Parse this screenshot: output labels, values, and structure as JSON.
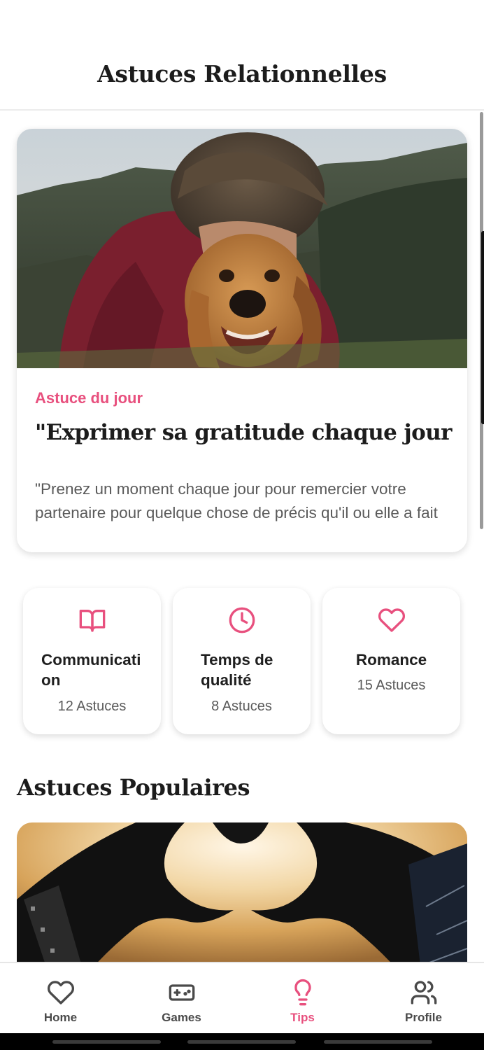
{
  "header": {
    "title": "Astuces Relationnelles"
  },
  "featured_tip": {
    "label": "Astuce du jour",
    "title": "\"Exprimer sa gratitude chaque jour",
    "body": "\"Prenez un moment chaque jour pour remercier votre partenaire pour quelque chose de précis qu'il ou elle a fait",
    "image": "man-hugging-golden-retriever-photo"
  },
  "categories": [
    {
      "icon": "book-icon",
      "name": "Communication",
      "count": "12 Astuces"
    },
    {
      "icon": "clock-icon",
      "name": "Temps de qualité",
      "count": "8 Astuces"
    },
    {
      "icon": "heart-icon",
      "name": "Romance",
      "count": "15 Astuces"
    }
  ],
  "popular": {
    "title": "Astuces Populaires",
    "image": "hands-forming-heart-sunset-photo"
  },
  "nav": {
    "items": [
      {
        "label": "Home",
        "icon": "heart-icon"
      },
      {
        "label": "Games",
        "icon": "gamepad-icon"
      },
      {
        "label": "Tips",
        "icon": "lightbulb-icon"
      },
      {
        "label": "Profile",
        "icon": "users-icon"
      }
    ],
    "active_index": 2
  },
  "colors": {
    "accent": "#e8507e",
    "text": "#1f1f1f",
    "muted": "#5a5a5a"
  }
}
